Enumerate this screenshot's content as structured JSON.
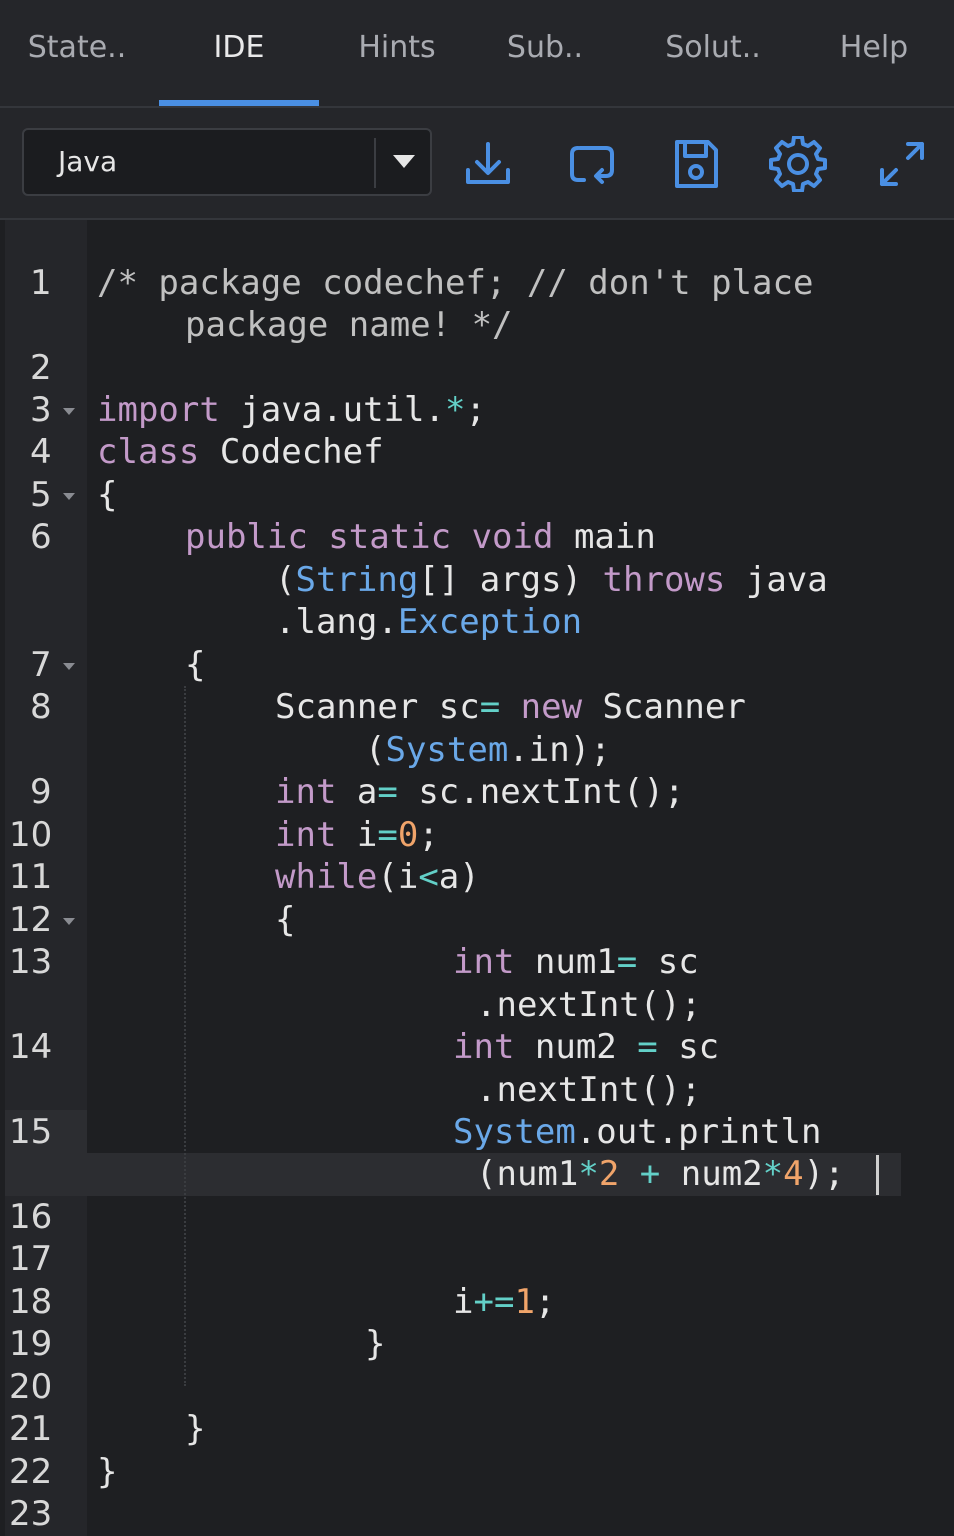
{
  "tabs": [
    {
      "label": "State..",
      "active": false
    },
    {
      "label": "IDE",
      "active": true
    },
    {
      "label": "Hints",
      "active": false
    },
    {
      "label": "Sub..",
      "active": false
    },
    {
      "label": "Solut..",
      "active": false
    },
    {
      "label": "Help",
      "active": false
    }
  ],
  "toolbar": {
    "language": "Java",
    "icons": [
      "download-icon",
      "reset-icon",
      "save-icon",
      "settings-icon",
      "fullscreen-icon"
    ],
    "accent_color": "#4a8fe3"
  },
  "editor": {
    "line_numbers": [
      "1",
      "2",
      "3",
      "4",
      "5",
      "6",
      "7",
      "8",
      "9",
      "10",
      "11",
      "12",
      "13",
      "14",
      "15",
      "16",
      "17",
      "18",
      "19",
      "20",
      "21",
      "22",
      "23"
    ],
    "active_line": "15",
    "code": {
      "l1a": "/* package codechef; // don't place",
      "l1b": "package name! */",
      "import_kw": "import",
      "import_rest": " java.util.",
      "import_star": "*",
      "import_semi": ";",
      "class_kw": "class",
      "class_name": " Codechef",
      "brace_open": "{",
      "public_kw": "public static void",
      "main": " main",
      "paren_open": "(",
      "string_type": "String",
      "args": "[] args) ",
      "throws_kw": "throws",
      "java": " java",
      "lang": ".lang.",
      "exception": "Exception",
      "method_brace": "{",
      "scanner_decl": "Scanner sc",
      "eq1": "=",
      "new_kw": " new",
      "scanner_ctor": " Scanner",
      "system_paren": "(",
      "system_type": "System",
      "system_in": ".in);",
      "int_kw1": "int",
      "a_decl": " a",
      "eq2": "=",
      "a_rest": " sc.nextInt();",
      "int_kw2": "int",
      "i_decl": " i",
      "eq3": "=",
      "zero": "0",
      "semi1": ";",
      "while_kw": "while",
      "while_cond_a": "(i",
      "lt": "<",
      "while_cond_b": "a)",
      "while_brace": "{",
      "int_kw3": "int",
      "num1_decl": " num1",
      "eq4": "=",
      "num1_rest": " sc",
      "nextint1": ".nextInt();",
      "int_kw4": "int",
      "num2_decl": " num2 ",
      "eq5": "=",
      "num2_rest": " sc",
      "nextint2": ".nextInt();",
      "println_type": "System",
      "println_rest": ".out.println",
      "println_arg_a": "(num1",
      "star1": "*",
      "two": "2",
      "plus": " + ",
      "println_arg_b": "num2",
      "star2": "*",
      "four": "4",
      "println_end": ");",
      "incr_i": "i",
      "incr_op": "+=",
      "incr_one": "1",
      "incr_semi": ";",
      "while_close": "}",
      "method_close": "}",
      "class_close": "}"
    }
  }
}
